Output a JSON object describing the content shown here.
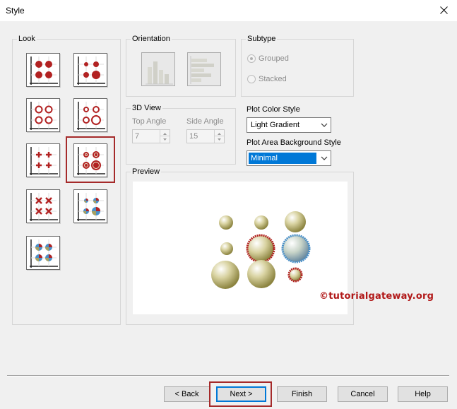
{
  "window": {
    "title": "Style",
    "close_label": "×"
  },
  "look": {
    "group_label": "Look",
    "items": [
      {
        "id": "solid-bubbles",
        "selected": false
      },
      {
        "id": "solid-bubbles-varied",
        "selected": false
      },
      {
        "id": "ring-bubbles",
        "selected": false
      },
      {
        "id": "ring-bubbles-varied",
        "selected": false
      },
      {
        "id": "cross-markers",
        "selected": false
      },
      {
        "id": "gradient-bubbles-varied",
        "selected": true
      },
      {
        "id": "x-markers",
        "selected": false
      },
      {
        "id": "pie-bubbles-varied",
        "selected": false
      },
      {
        "id": "pie-bubbles",
        "selected": false
      }
    ]
  },
  "orientation": {
    "group_label": "Orientation",
    "vertical_icon": "vertical-bars-icon",
    "horizontal_icon": "horizontal-bars-icon"
  },
  "subtype": {
    "group_label": "Subtype",
    "options": [
      {
        "label": "Grouped",
        "checked": true
      },
      {
        "label": "Stacked",
        "checked": false
      }
    ]
  },
  "view3d": {
    "group_label": "3D View",
    "top_angle_label": "Top Angle",
    "top_angle_value": "7",
    "side_angle_label": "Side Angle",
    "side_angle_value": "15"
  },
  "plot_color_style": {
    "label": "Plot Color Style",
    "value": "Light Gradient"
  },
  "plot_area_background": {
    "label": "Plot Area Background Style",
    "value": "Minimal"
  },
  "preview": {
    "group_label": "Preview",
    "watermark": "©tutorialgateway.org"
  },
  "buttons": {
    "back": "< Back",
    "next": "Next >",
    "finish": "Finish",
    "cancel": "Cancel",
    "help": "Help"
  },
  "colors": {
    "accent": "#0078d7",
    "highlight_border": "#a52a2a",
    "bubble_red": "#b22222",
    "bubble_olive": "#a8a060",
    "bubble_blue": "#4a90c8"
  }
}
